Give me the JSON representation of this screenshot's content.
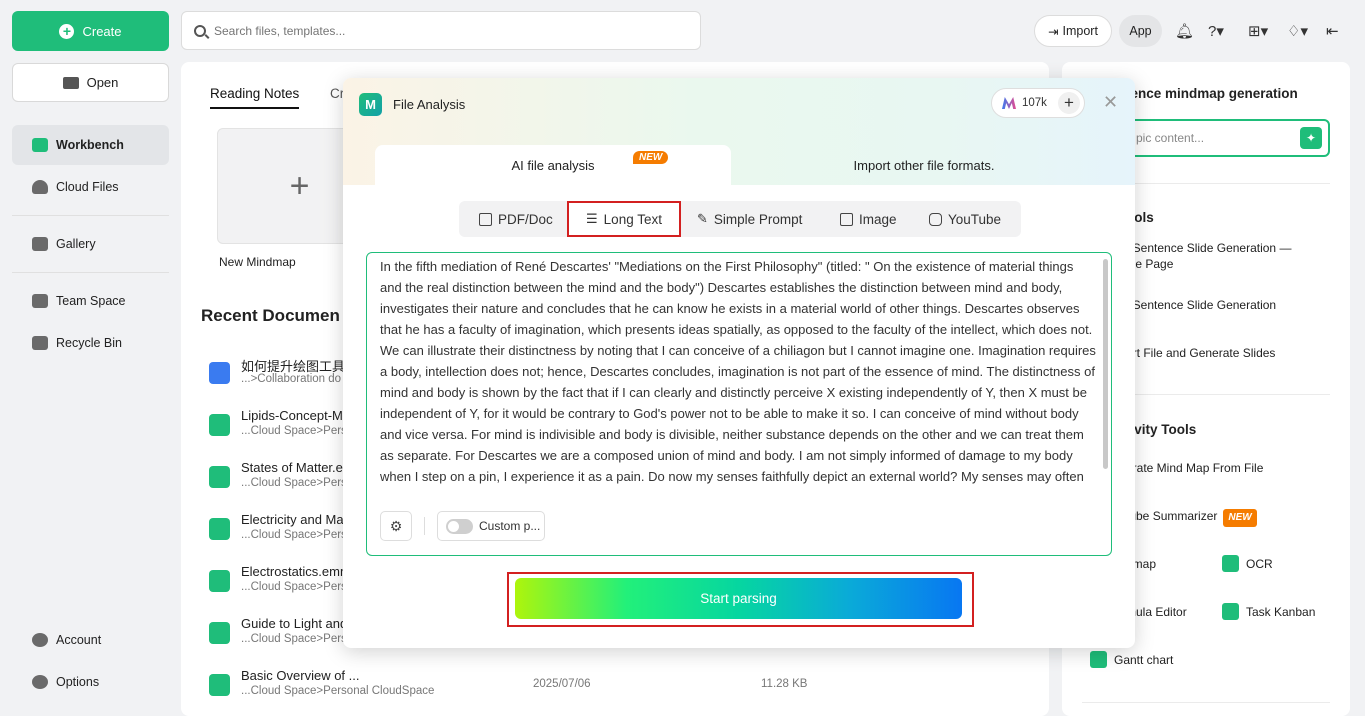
{
  "sidebar": {
    "create_label": "Create",
    "open_label": "Open",
    "items": [
      {
        "label": "Workbench"
      },
      {
        "label": "Cloud Files"
      },
      {
        "label": "Gallery"
      },
      {
        "label": "Team Space"
      },
      {
        "label": "Recycle Bin"
      }
    ],
    "account_label": "Account",
    "options_label": "Options"
  },
  "topbar": {
    "search_placeholder": "Search files, templates...",
    "import_label": "Import",
    "app_label": "App"
  },
  "main": {
    "tab_reading": "Reading Notes",
    "tab_cr": "Cr",
    "new_mindmap_label": "New Mindmap",
    "recent_title": "Recent Documen",
    "docs": [
      {
        "name": "如何提升绘图工具",
        "path": "...>Collaboration do",
        "date": "",
        "size": ""
      },
      {
        "name": "Lipids-Concept-M",
        "path": "...Cloud Space>Pers",
        "date": "",
        "size": ""
      },
      {
        "name": "States of Matter.e",
        "path": "...Cloud Space>Pers",
        "date": "",
        "size": ""
      },
      {
        "name": "Electricity and Ma",
        "path": "...Cloud Space>Pers",
        "date": "",
        "size": ""
      },
      {
        "name": "Electrostatics.emm",
        "path": "...Cloud Space>Pers",
        "date": "",
        "size": ""
      },
      {
        "name": "Guide to Light and",
        "path": "...Cloud Space>Pers",
        "date": "",
        "size": ""
      },
      {
        "name": "Basic Overview of ...",
        "path": "...Cloud Space>Personal CloudSpace",
        "date": "2025/07/06",
        "size": "11.28 KB"
      }
    ]
  },
  "right": {
    "title": "tence mindmap generation",
    "input_placeholder": "pic content...",
    "sec_tools": "ools",
    "tool_items": [
      "–Sentence Slide Generation — gle Page",
      "–Sentence Slide Generation",
      "ort File and Generate Slides"
    ],
    "sec_productivity": "tivity Tools",
    "prod_items": [
      "erate Mind Map From File",
      "tube Summarizer"
    ],
    "new_badge": "NEW",
    "grid_items": [
      {
        "left": "emap",
        "right": "OCR"
      },
      {
        "left": "mula Editor",
        "right": "Task Kanban"
      }
    ],
    "gantt_label": "Gantt chart"
  },
  "modal": {
    "title": "File Analysis",
    "credits": "107k",
    "tab_ai": "AI file analysis",
    "tab_ai_badge": "NEW",
    "tab_import": "Import other file formats.",
    "segments": [
      "PDF/Doc",
      "Long Text",
      "Simple Prompt",
      "Image",
      "YouTube"
    ],
    "text": "In the fifth mediation of René Descartes' \"Mediations on the First Philosophy\" (titled: \" On the existence of material things and the real distinction between the mind and the body\") Descartes establishes the distinction between mind and body, investigates their nature and concludes that he can know he exists in a material world of other things. Descartes observes that he has a faculty of imagination, which presents ideas spatially, as opposed to the faculty of the intellect, which does not. We can illustrate their distinctness by noting that I can conceive of a chiliagon but I cannot imagine one. Imagination requires a body, intellection does not; hence, Descartes concludes, imagination is not part of the essence of mind. The distinctness of mind and body is shown by the fact that if I can clearly and distinctly perceive X existing independently of Y, then X must be independent of Y, for it would be contrary to God's power not to be able to make it so. I can conceive of mind without body and vice versa. For mind is indivisible and body is divisible, neither substance depends on the other and we can treat them as separate. For Descartes we are a composed union of mind and body. I am not simply informed of damage to my body when I step on a pin, I experience it as a pain. Do now my senses faithfully depict an external world? My senses may often",
    "custom_label": "Custom p...",
    "start_label": "Start parsing"
  }
}
